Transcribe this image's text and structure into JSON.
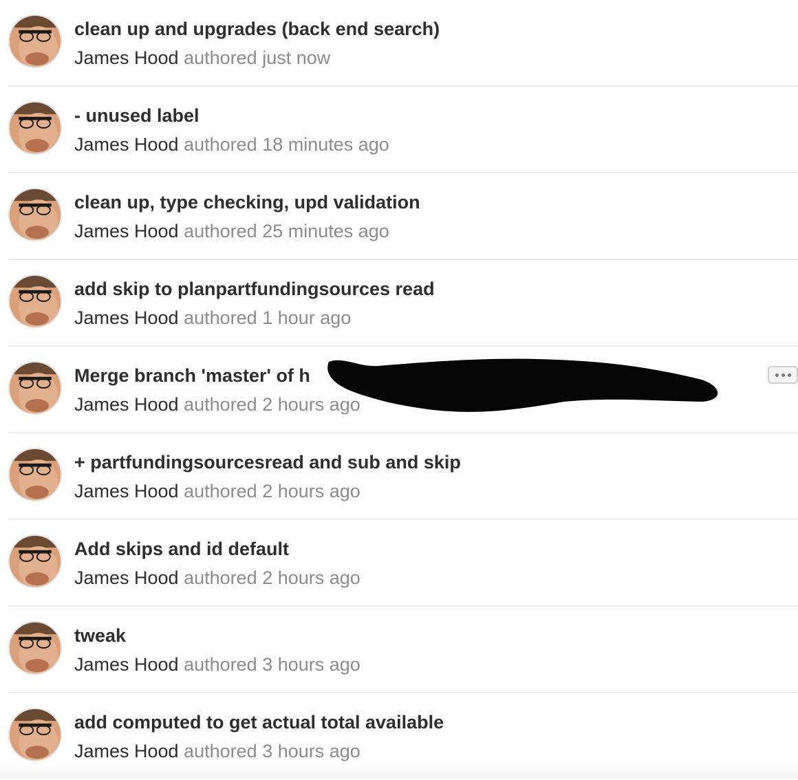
{
  "commits": [
    {
      "title": "clean up and upgrades (back end search)",
      "author": "James Hood",
      "authored_label": "authored",
      "time": "just now"
    },
    {
      "title": "- unused label",
      "author": "James Hood",
      "authored_label": "authored",
      "time": "18 minutes ago"
    },
    {
      "title": "clean up, type checking, upd validation",
      "author": "James Hood",
      "authored_label": "authored",
      "time": "25 minutes ago"
    },
    {
      "title": "add skip to planpartfundingsources read",
      "author": "James Hood",
      "authored_label": "authored",
      "time": "1 hour ago"
    },
    {
      "title": "Merge branch 'master' of h                                   ...",
      "author": "James Hood",
      "authored_label": "authored",
      "time": "2 hours ago",
      "has_more_button": true
    },
    {
      "title": "+ partfundingsourcesread and sub and skip",
      "author": "James Hood",
      "authored_label": "authored",
      "time": "2 hours ago"
    },
    {
      "title": "Add skips and id default",
      "author": "James Hood",
      "authored_label": "authored",
      "time": "2 hours ago"
    },
    {
      "title": "tweak",
      "author": "James Hood",
      "authored_label": "authored",
      "time": "3 hours ago"
    },
    {
      "title": "add computed to get actual total available",
      "author": "James Hood",
      "authored_label": "authored",
      "time": "3 hours ago"
    }
  ],
  "icons": {
    "avatar": "user-avatar-photo",
    "more": "ellipsis-icon"
  },
  "colors": {
    "title": "#2e2e2e",
    "muted": "#8c8c8c",
    "divider": "#ececec"
  }
}
